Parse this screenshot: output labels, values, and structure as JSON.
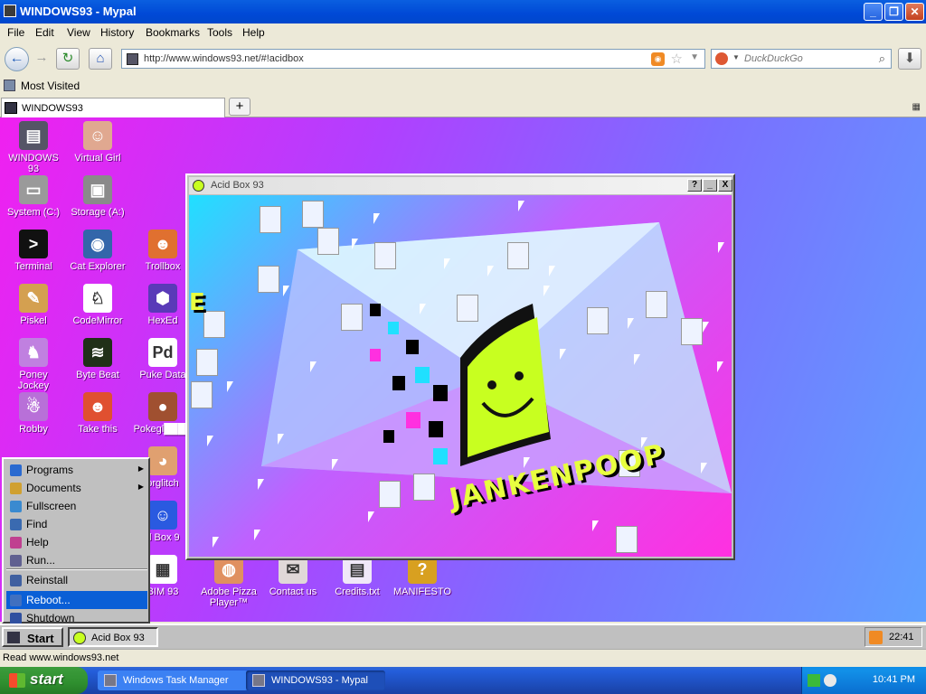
{
  "browser": {
    "window_title": "WINDOWS93 - Mypal",
    "menu": [
      "File",
      "Edit",
      "View",
      "History",
      "Bookmarks",
      "Tools",
      "Help"
    ],
    "url": "http://www.windows93.net/#!acidbox",
    "search_placeholder": "DuckDuckGo",
    "bookmark_most_visited": "Most Visited",
    "tab_title": "WINDOWS93",
    "new_tab": "+",
    "status": "Read www.windows93.net"
  },
  "desktop": {
    "icons": [
      {
        "label": "WINDOWS 93",
        "color": "#555566",
        "glyph": "▤"
      },
      {
        "label": "Virtual Girl",
        "color": "#e0a890",
        "glyph": "☺"
      },
      {
        "label": "System (C:)",
        "color": "#9a9a9a",
        "glyph": "▭"
      },
      {
        "label": "Storage (A:)",
        "color": "#8a8a8a",
        "glyph": "▣"
      },
      {
        "label": "Terminal",
        "color": "#111111",
        "glyph": ">"
      },
      {
        "label": "Cat Explorer",
        "color": "#3366aa",
        "glyph": "◉"
      },
      {
        "label": "Trollbox",
        "color": "#e07030",
        "glyph": "☻"
      },
      {
        "label": "Piskel",
        "color": "#d4a050",
        "glyph": "✎"
      },
      {
        "label": "CodeMirror",
        "color": "#ffffff",
        "glyph": "♘"
      },
      {
        "label": "HexEd",
        "color": "#5a3ab8",
        "glyph": "⬢"
      },
      {
        "label": "Poney\nJockey",
        "color": "#c080e0",
        "glyph": "♞"
      },
      {
        "label": "Byte Beat",
        "color": "#203018",
        "glyph": "≋"
      },
      {
        "label": "Puke Data",
        "color": "#ffffff",
        "glyph": "Pd"
      },
      {
        "label": "Robby",
        "color": "#b870d8",
        "glyph": "☃"
      },
      {
        "label": "Take this",
        "color": "#e05030",
        "glyph": "☻"
      },
      {
        "label": "Pokegl████",
        "color": "#a05030",
        "glyph": "●"
      },
      {
        "label": "orglitch",
        "color": "#e0a070",
        "glyph": "◕"
      },
      {
        "label": "d Box 9",
        "color": "#2a5ae0",
        "glyph": "☺"
      },
      {
        "label": "BIM 93",
        "color": "#ffffff",
        "glyph": "▦"
      },
      {
        "label": "Adobe Pizza\nPlayer™",
        "color": "#e09060",
        "glyph": "◍"
      },
      {
        "label": "Contact us",
        "color": "#e0d8d8",
        "glyph": "✉"
      },
      {
        "label": "Credits.txt",
        "color": "#f0e8f8",
        "glyph": "▤"
      },
      {
        "label": "MANIFESTO",
        "color": "#d8a020",
        "glyph": "?"
      }
    ]
  },
  "acidbox": {
    "title": "Acid Box 93",
    "help_btn": "?",
    "min_btn": "_",
    "close_btn": "X",
    "text_jank": "JANKENPOOP",
    "text_e": "E"
  },
  "startmenu": {
    "items": [
      {
        "label": "Programs",
        "arrow": "▶",
        "color": "#2a6ad0"
      },
      {
        "label": "Documents",
        "arrow": "▶",
        "color": "#d0a030"
      },
      {
        "label": "Fullscreen",
        "arrow": "",
        "color": "#3a8ad0"
      },
      {
        "label": "Find",
        "arrow": "",
        "color": "#3a6ab0"
      },
      {
        "label": "Help",
        "arrow": "",
        "color": "#c04090"
      },
      {
        "label": "Run...",
        "arrow": "",
        "color": "#606090"
      },
      {
        "label": "Reinstall",
        "arrow": "",
        "color": "#4060a0"
      },
      {
        "label": "Reboot...",
        "arrow": "",
        "color": "#4070c0"
      },
      {
        "label": "Shutdown",
        "arrow": "",
        "color": "#3050a0"
      }
    ]
  },
  "w93taskbar": {
    "start": "Start",
    "task": "Acid Box 93",
    "time": "22:41"
  },
  "xptaskbar": {
    "start": "start",
    "tasks": [
      "Windows Task Manager",
      "WINDOWS93 - Mypal"
    ],
    "time": "10:41 PM"
  }
}
